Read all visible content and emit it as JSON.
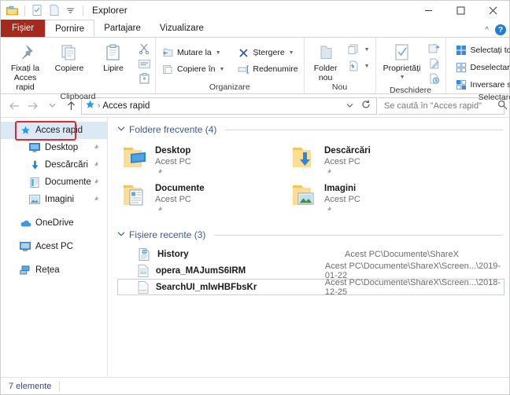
{
  "window": {
    "title": "Explorer",
    "quick_access_toolbar": [
      {
        "name": "folder-icon",
        "label": "Explorer"
      },
      {
        "name": "properties-icon",
        "label": "Proprietăți"
      },
      {
        "name": "new-folder-icon",
        "label": "Folder nou"
      },
      {
        "name": "customize-qat-icon",
        "label": "Particularizare bară de instrumente Acces rapid"
      }
    ],
    "controls": {
      "minimize": "—",
      "maximize": "☐",
      "close": "✕"
    }
  },
  "ribbon": {
    "tabs": [
      {
        "label": "Fișier",
        "type": "file",
        "active": false
      },
      {
        "label": "Pornire",
        "type": "normal",
        "active": true
      },
      {
        "label": "Partajare",
        "type": "normal",
        "active": false
      },
      {
        "label": "Vizualizare",
        "type": "normal",
        "active": false
      }
    ],
    "collapse_icon": "chevron-up-icon",
    "help_icon": "?",
    "groups": [
      {
        "label": "Clipboard",
        "big_buttons": [
          {
            "label": "Fixați la Acces rapid",
            "icon": "pin-icon"
          },
          {
            "label": "Copiere",
            "icon": "copy-icon"
          },
          {
            "label": "Lipire",
            "icon": "paste-icon"
          }
        ],
        "mini_buttons": [
          {
            "icon": "cut-icon",
            "label": "Decupare"
          },
          {
            "icon": "copy-path-icon",
            "label": "Copiere cale"
          },
          {
            "icon": "paste-shortcut-icon",
            "label": "Lipire comandă rapidă"
          }
        ]
      },
      {
        "label": "Organizare",
        "small_buttons": [
          {
            "label": "Mutare la",
            "icon": "move-to-icon",
            "has_caret": true
          },
          {
            "label": "Copiere în",
            "icon": "copy-to-icon",
            "has_caret": true
          },
          {
            "label": "Ștergere",
            "icon": "delete-icon",
            "has_caret": true
          },
          {
            "label": "Redenumire",
            "icon": "rename-icon",
            "has_caret": false
          }
        ]
      },
      {
        "label": "Nou",
        "big_buttons": [
          {
            "label": "Folder nou",
            "icon": "new-folder-icon"
          }
        ],
        "small_buttons": [
          {
            "label": "",
            "icon": "new-item-icon",
            "has_caret": true
          },
          {
            "label": "",
            "icon": "easy-access-icon",
            "has_caret": true
          }
        ]
      },
      {
        "label": "Deschidere",
        "big_buttons": [
          {
            "label": "Proprietăți",
            "icon": "properties-icon",
            "has_caret": true
          }
        ],
        "mini_buttons": [
          {
            "icon": "open-with-icon",
            "label": "Deschidere cu"
          },
          {
            "icon": "edit-icon",
            "label": "Editare"
          },
          {
            "icon": "history-icon",
            "label": "Istoric"
          }
        ]
      },
      {
        "label": "Selectare",
        "select_buttons": [
          {
            "label": "Selectați tot",
            "icon": "select-all-icon"
          },
          {
            "label": "Deselectare totală",
            "icon": "select-none-icon"
          },
          {
            "label": "Inversare selecție",
            "icon": "invert-selection-icon"
          }
        ]
      }
    ]
  },
  "addressbar": {
    "back_icon": "arrow-left-icon",
    "forward_icon": "arrow-right-icon",
    "recent_icon": "chevron-down-icon",
    "up_icon": "arrow-up-icon",
    "breadcrumb_icon": "quick-access-star-icon",
    "breadcrumb": "Acces rapid",
    "breadcrumb_separator": "›",
    "dropdown_icon": "chevron-down-icon",
    "refresh_icon": "refresh-icon",
    "search_placeholder": "Se caută în \"Acces rapid\"",
    "search_value": "",
    "search_icon": "search-icon"
  },
  "sidebar": {
    "items": [
      {
        "label": "Acces rapid",
        "icon": "star-icon",
        "level": 0,
        "selected": true,
        "pinned": false,
        "highlighted": true
      },
      {
        "label": "Desktop",
        "icon": "desktop-icon",
        "level": 1,
        "selected": false,
        "pinned": true
      },
      {
        "label": "Descărcări",
        "icon": "downloads-icon",
        "level": 1,
        "selected": false,
        "pinned": true
      },
      {
        "label": "Documente",
        "icon": "documents-icon",
        "level": 1,
        "selected": false,
        "pinned": true
      },
      {
        "label": "Imagini",
        "icon": "pictures-icon",
        "level": 1,
        "selected": false,
        "pinned": true
      },
      {
        "label": "OneDrive",
        "icon": "cloud-icon",
        "level": 0,
        "selected": false,
        "pinned": false,
        "gap_before": true
      },
      {
        "label": "Acest PC",
        "icon": "this-pc-icon",
        "level": 0,
        "selected": false,
        "pinned": false,
        "gap_before": true
      },
      {
        "label": "Rețea",
        "icon": "network-icon",
        "level": 0,
        "selected": false,
        "pinned": false,
        "gap_before": true
      }
    ]
  },
  "content": {
    "frequent": {
      "header": "Foldere frecvente (4)",
      "chevron": "∨",
      "items": [
        {
          "name": "Desktop",
          "sub": "Acest PC",
          "icon": "folder-desktop-icon",
          "pinned": true
        },
        {
          "name": "Descărcări",
          "sub": "Acest PC",
          "icon": "folder-downloads-icon",
          "pinned": true
        },
        {
          "name": "Documente",
          "sub": "Acest PC",
          "icon": "folder-documents-icon",
          "pinned": true
        },
        {
          "name": "Imagini",
          "sub": "Acest PC",
          "icon": "folder-pictures-icon",
          "pinned": true
        }
      ]
    },
    "recent": {
      "header": "Fișiere recente (3)",
      "chevron": "∨",
      "items": [
        {
          "name": "History",
          "path": "Acest PC\\Documente\\ShareX",
          "icon": "html-document-icon",
          "selected": false
        },
        {
          "name": "opera_MAJumS6IRM",
          "path": "Acest PC\\Documente\\ShareX\\Screen...\\2019-01-22",
          "icon": "image-file-icon",
          "selected": false
        },
        {
          "name": "SearchUI_mlwHBFbsKr",
          "path": "Acest PC\\Documente\\ShareX\\Screen...\\2018-12-25",
          "icon": "image-file-icon",
          "selected": true
        }
      ]
    }
  },
  "statusbar": {
    "item_count": "7 elemente"
  },
  "colors": {
    "file_tab_red": "#a6291d",
    "section_header_blue": "#3c5a96",
    "selection_blue": "#dbe9f7",
    "annotation_red": "#e8252a",
    "folder_yellow": "#fcd98a",
    "accent_blue": "#1f7fd4"
  }
}
